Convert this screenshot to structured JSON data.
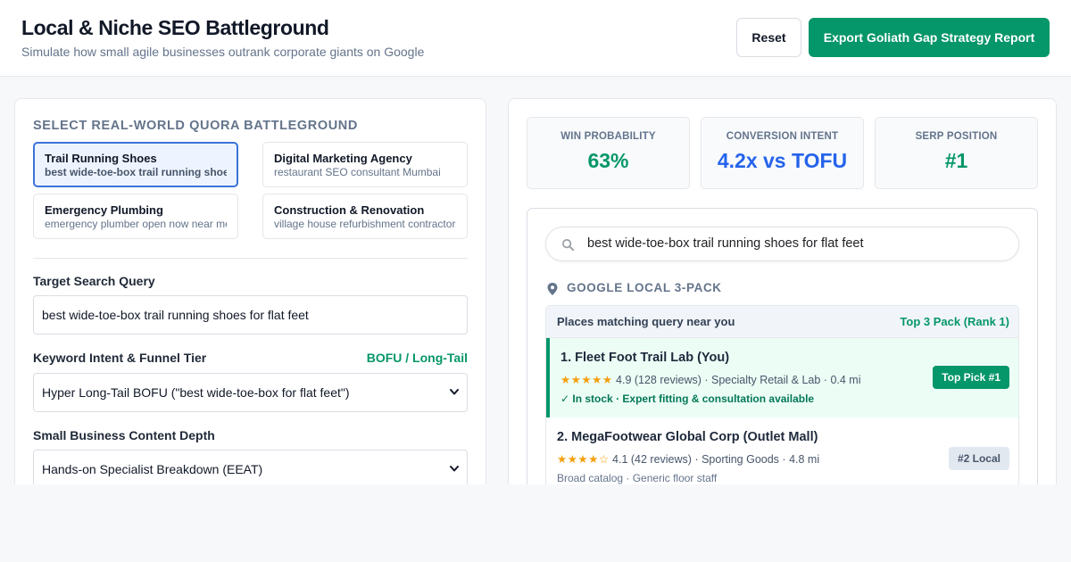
{
  "header": {
    "title": "Local & Niche SEO Battleground",
    "subtitle": "Simulate how small agile businesses outrank corporate giants on Google",
    "reset_label": "Reset",
    "export_label": "Export Goliath Gap Strategy Report"
  },
  "left": {
    "section_title": "SELECT REAL-WORLD QUORA BATTLEGROUND",
    "battlegrounds": [
      {
        "title": "Trail Running Shoes",
        "subtitle": "best wide-toe-box trail running shoes...",
        "selected": true
      },
      {
        "title": "Digital Marketing Agency",
        "subtitle": "restaurant SEO consultant Mumbai",
        "selected": false
      },
      {
        "title": "Emergency Plumbing",
        "subtitle": "emergency plumber open now near me",
        "selected": false
      },
      {
        "title": "Construction & Renovation",
        "subtitle": "village house refurbishment contractor",
        "selected": false
      }
    ],
    "query_label": "Target Search Query",
    "query_value": "best wide-toe-box trail running shoes for flat feet",
    "intent_label": "Keyword Intent & Funnel Tier",
    "intent_tag": "BOFU / Long-Tail",
    "intent_value": "Hyper Long-Tail BOFU (\"best wide-toe-box for flat feet\")",
    "depth_label": "Small Business Content Depth",
    "depth_value": "Hands-on Specialist Breakdown (EEAT)"
  },
  "stats": [
    {
      "label": "WIN PROBABILITY",
      "value": "63%",
      "color": "#059669"
    },
    {
      "label": "CONVERSION INTENT",
      "value": "4.2x vs TOFU",
      "color": "#2563eb"
    },
    {
      "label": "SERP POSITION",
      "value": "#1",
      "color": "#059669"
    }
  ],
  "serp": {
    "search_text": "best wide-toe-box trail running shoes for flat feet",
    "pack_label": "GOOGLE LOCAL 3-PACK",
    "results_header": "Places matching query near you",
    "results_rank": "Top 3 Pack (Rank 1)",
    "results": [
      {
        "name": "1. Fleet Foot Trail Lab (You)",
        "stars": "★★★★★",
        "rating": "4.9 (128 reviews)",
        "category": "Specialty Retail & Lab",
        "distance": "0.4 mi",
        "note": "✓ In stock · Expert fitting & consultation available",
        "badge": "Top Pick #1"
      },
      {
        "name": "2. MegaFootwear Global Corp (Outlet Mall)",
        "stars": "★★★★☆",
        "rating": "4.1 (42 reviews)",
        "category": "Sporting Goods",
        "distance": "4.8 mi",
        "note": "Broad catalog · Generic floor staff",
        "badge": "#2 Local"
      }
    ]
  }
}
